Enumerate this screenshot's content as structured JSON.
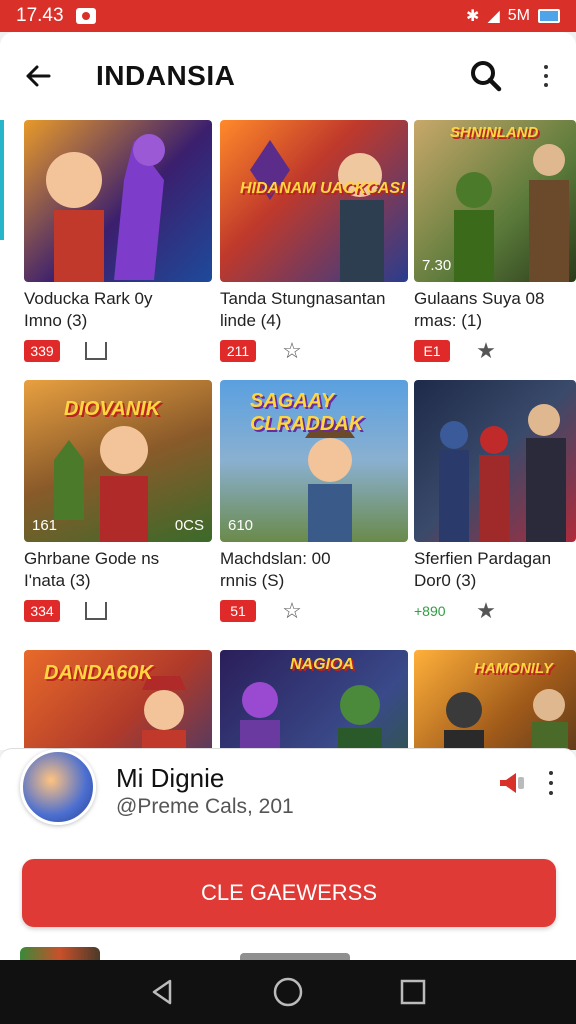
{
  "status": {
    "time": "17.43",
    "network": "5M"
  },
  "appbar": {
    "title": "INDANSIA"
  },
  "videos": [
    {
      "caption1": "Voducka Rark 0y",
      "caption2": "Imno (3)",
      "badge": "339",
      "thumb_tag": "",
      "thumb_tag2": "",
      "colors": [
        "#3b1f6e",
        "#e89a2a"
      ]
    },
    {
      "caption1": "Tanda Stungnasantan",
      "caption2": "linde (4)",
      "badge": "211",
      "thumb_tag": "",
      "thumb_tag2": "",
      "logo": "HIDANAM UACKCAS!",
      "colors": [
        "#2a3c8e",
        "#ff8a2a"
      ]
    },
    {
      "caption1": "Gulaans Suya 08",
      "caption2": "rmas: (1)",
      "badge": "E1",
      "thumb_tag": "7.30",
      "thumb_tag2": "",
      "logo": "SHNINLAND",
      "colors": [
        "#5a7a3a",
        "#c8a86a"
      ]
    },
    {
      "caption1": "Ghrbane Gode ns",
      "caption2": "I'nata (3)",
      "badge": "334",
      "thumb_tag": "161",
      "thumb_tag2": "0CS",
      "logo": "DIOVANIK",
      "colors": [
        "#e8a040",
        "#3a6a2a"
      ]
    },
    {
      "caption1": "Machdslan: 00",
      "caption2": "rnnis (S)",
      "badge": "51",
      "thumb_tag": "610",
      "thumb_tag2": "",
      "logo": "SAGAAY CLRADDAK",
      "colors": [
        "#5aa0e0",
        "#8aa45a"
      ]
    },
    {
      "caption1": "Sferfien Pardagan",
      "caption2": "Dor0 (3)",
      "badge": "+890",
      "thumb_tag": "",
      "thumb_tag2": "",
      "colors": [
        "#1e2a4a",
        "#b02a3a"
      ]
    },
    {
      "caption1": "",
      "caption2": "",
      "badge": "",
      "thumb_tag": "",
      "thumb_tag2": "",
      "logo": "DANDA60K",
      "colors": [
        "#e86a2a",
        "#2a3a7a"
      ]
    },
    {
      "caption1": "",
      "caption2": "",
      "badge": "",
      "thumb_tag": "",
      "thumb_tag2": "",
      "logo": "NAGIOA",
      "colors": [
        "#2a1e5a",
        "#4aa02a"
      ]
    },
    {
      "caption1": "",
      "caption2": "",
      "badge": "",
      "thumb_tag": "",
      "thumb_tag2": "",
      "logo": "HAMONILY",
      "colors": [
        "#3a2a1a",
        "#ffb03a"
      ]
    }
  ],
  "channel": {
    "name": "Mi Dignie",
    "subtitle": "@Preme Cals, 201",
    "cta": "CLE GAEWERSS"
  },
  "colors": {
    "accent": "#d9302a",
    "cta": "#df3a35"
  }
}
